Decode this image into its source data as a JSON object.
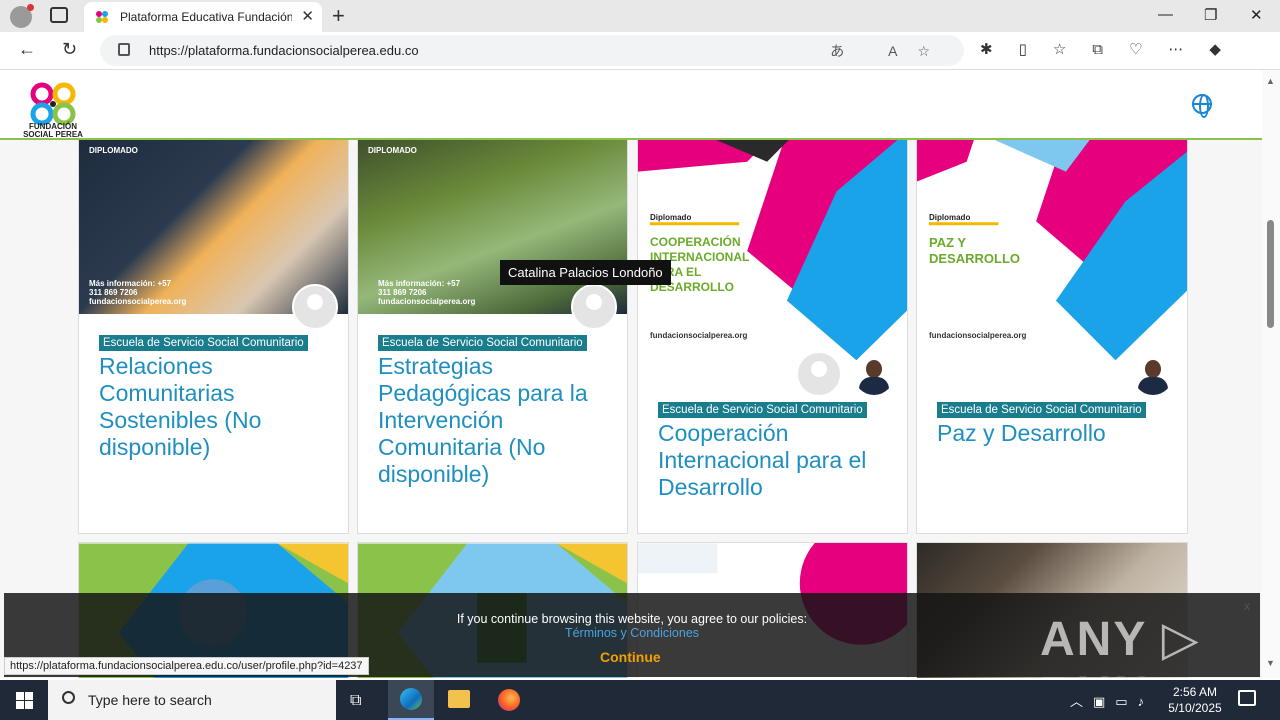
{
  "browser": {
    "tab_title": "Plataforma Educativa Fundación",
    "tab_close": "✕",
    "new_tab": "+",
    "url": "https://plataforma.fundacionsocialperea.edu.co",
    "window_controls": {
      "minimize": "—",
      "maximize": "❐",
      "close": "✕"
    },
    "status_url": "https://plataforma.fundacionsocialperea.edu.co/user/profile.php?id=4237"
  },
  "site": {
    "logo_text": "FUNDACIÓN SOCIAL PEREA"
  },
  "courses_row1": [
    {
      "category": "Escuela de Servicio Social Comunitario",
      "title": "Relaciones Comunitarias Sostenibles (No disponible)",
      "image_label": "DIPLOMADO",
      "image_contact": "Más información: +57 311 869 7206",
      "image_site": "fundacionsocialperea.org"
    },
    {
      "category": "Escuela de Servicio Social Comunitario",
      "title": "Estrategias Pedagógicas para la Intervención Comunitaria (No disponible)",
      "image_label": "DIPLOMADO",
      "image_contact": "Más información: +57 311 869 7206",
      "image_site": "fundacionsocialperea.org"
    },
    {
      "category": "Escuela de Servicio Social Comunitario",
      "title": "Cooperación Internacional para el Desarrollo",
      "image_label": "Diplomado",
      "image_heading": "COOPERACIÓN INTERNACIONAL PARA EL DESARROLLO",
      "image_site": "fundacionsocialperea.org"
    },
    {
      "category": "Escuela de Servicio Social Comunitario",
      "title": "Paz y Desarrollo",
      "image_label": "Diplomado",
      "image_heading": "PAZ Y DESARROLLO",
      "image_site": "fundacionsocialperea.org"
    }
  ],
  "tooltip": "Catalina Palacios Londoño",
  "cookie": {
    "message": "If you continue browsing this website, you agree to our policies:",
    "link": "Términos y Condiciones",
    "button": "Continue",
    "close": "x"
  },
  "watermark": "ANY ▷ RUN",
  "taskbar": {
    "search_placeholder": "Type here to search",
    "time": "2:56 AM",
    "date": "5/10/2025"
  },
  "colors": {
    "accent_green": "#8bc34a",
    "badge_teal": "#1a7d8e",
    "title_blue": "#1f8fc1",
    "magenta": "#e6007e",
    "sky_blue": "#1aa3e8"
  }
}
